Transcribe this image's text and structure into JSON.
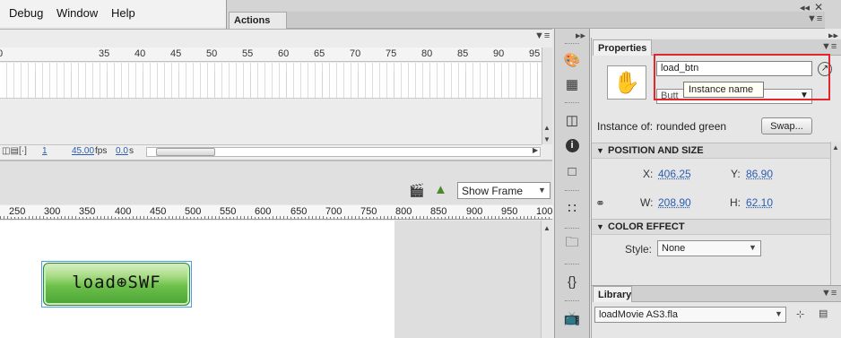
{
  "menu": {
    "items": [
      "Debug",
      "Window",
      "Help"
    ]
  },
  "actions_panel": {
    "tab_label": "Actions"
  },
  "timeline": {
    "frame_numbers": [
      "0",
      "35",
      "40",
      "45",
      "50",
      "55",
      "60",
      "65",
      "70",
      "75",
      "80",
      "85",
      "90",
      "95"
    ],
    "status": {
      "current_frame": "1",
      "fps_value": "45.00",
      "fps_unit": "fps",
      "time_value": "0.0",
      "time_unit": "s"
    }
  },
  "edit_bar": {
    "zoom_value": "Show Frame"
  },
  "stage_ruler": {
    "ticks": [
      "250",
      "300",
      "350",
      "400",
      "450",
      "500",
      "550",
      "600",
      "650",
      "700",
      "750",
      "800",
      "850",
      "900",
      "950",
      "100"
    ]
  },
  "stage": {
    "button_label": "load⊕SWF"
  },
  "properties": {
    "tab_label": "Properties",
    "instance_name_value": "load_btn",
    "instance_name_tooltip": "Instance name",
    "symbol_type_value": "Butt",
    "instance_of_label": "Instance of:",
    "instance_of_value": "rounded green",
    "swap_label": "Swap...",
    "position_section": "POSITION AND SIZE",
    "x_label": "X:",
    "x_value": "406.25",
    "y_label": "Y:",
    "y_value": "86.90",
    "w_label": "W:",
    "w_value": "208.90",
    "h_label": "H:",
    "h_value": "62.10",
    "color_section": "COLOR EFFECT",
    "style_label": "Style:",
    "style_value": "None"
  },
  "library": {
    "tab_label": "Library",
    "document_value": "loadMovie AS3.fla"
  },
  "colors": {
    "highlight_border": "#e3262c",
    "button_green": "#6cc04a",
    "link_blue": "#2a5db0"
  }
}
